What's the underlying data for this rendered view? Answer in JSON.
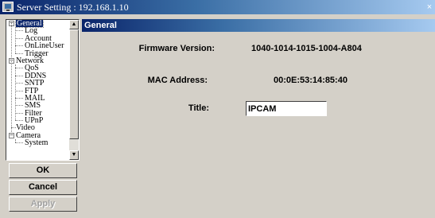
{
  "window": {
    "title": "Server Setting : 192.168.1.10",
    "close_glyph": "×"
  },
  "tree": {
    "items": [
      {
        "label": "General",
        "level": 0,
        "expander": "−",
        "selected": true
      },
      {
        "label": "Log",
        "level": 1
      },
      {
        "label": "Account",
        "level": 1
      },
      {
        "label": "OnLineUser",
        "level": 1
      },
      {
        "label": "Trigger",
        "level": 1
      },
      {
        "label": "Network",
        "level": 0,
        "expander": "−"
      },
      {
        "label": "QoS",
        "level": 1
      },
      {
        "label": "DDNS",
        "level": 1
      },
      {
        "label": "SNTP",
        "level": 1
      },
      {
        "label": "FTP",
        "level": 1
      },
      {
        "label": "MAIL",
        "level": 1
      },
      {
        "label": "SMS",
        "level": 1
      },
      {
        "label": "Filter",
        "level": 1
      },
      {
        "label": "UPnP",
        "level": 1
      },
      {
        "label": "Video",
        "level": 0
      },
      {
        "label": "Camera",
        "level": 0,
        "expander": "−"
      },
      {
        "label": "System",
        "level": 1
      }
    ]
  },
  "buttons": {
    "ok": "OK",
    "cancel": "Cancel",
    "apply": "Apply"
  },
  "panel": {
    "header": "General",
    "firmware_label": "Firmware Version:",
    "firmware_value": "1040-1014-1015-1004-A804",
    "mac_label": "MAC Address:",
    "mac_value": "00:0E:53:14:85:40",
    "title_label": "Title:",
    "title_value": "IPCAM"
  },
  "colors": {
    "window_bg": "#d4d0c8",
    "titlebar_dark": "#0a246a",
    "titlebar_light": "#a6caf0",
    "selection": "#0a246a"
  }
}
